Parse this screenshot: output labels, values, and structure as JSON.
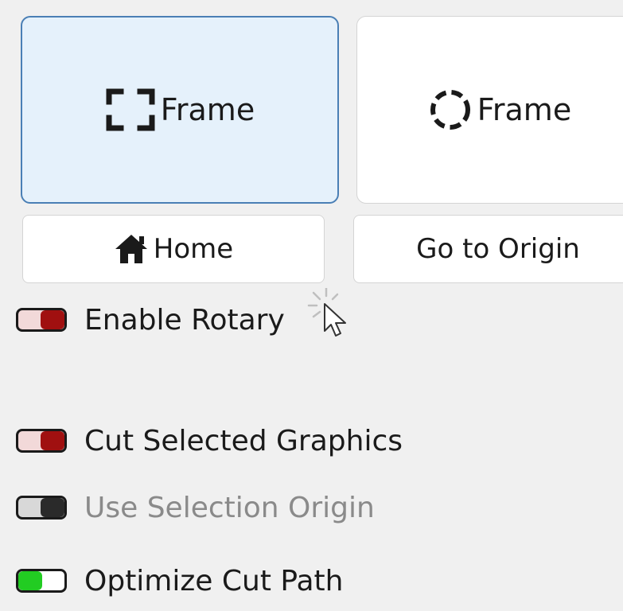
{
  "buttons": {
    "frame_rect_label": "Frame",
    "frame_circle_label": "Frame",
    "home_label": "Home",
    "origin_label": "Go to Origin"
  },
  "toggles": {
    "rotary": {
      "label": "Enable Rotary",
      "state": "off",
      "color": "#a01010"
    },
    "cut_selected": {
      "label": "Cut Selected Graphics",
      "state": "off",
      "color": "#a01010"
    },
    "selection_origin": {
      "label": "Use Selection Origin",
      "state": "disabled",
      "color": "#2a2a2a"
    },
    "optimize": {
      "label": "Optimize Cut Path",
      "state": "on",
      "color": "#22cc22"
    }
  },
  "icons": {
    "frame_rect": "dashed-square-icon",
    "frame_circle": "dashed-circle-icon",
    "home": "house-icon",
    "cursor": "click-cursor-icon"
  },
  "colors": {
    "selected_bg": "#e5f1fb",
    "selected_border": "#4a7fb5",
    "toggle_off": "#a01010",
    "toggle_on": "#22cc22"
  }
}
